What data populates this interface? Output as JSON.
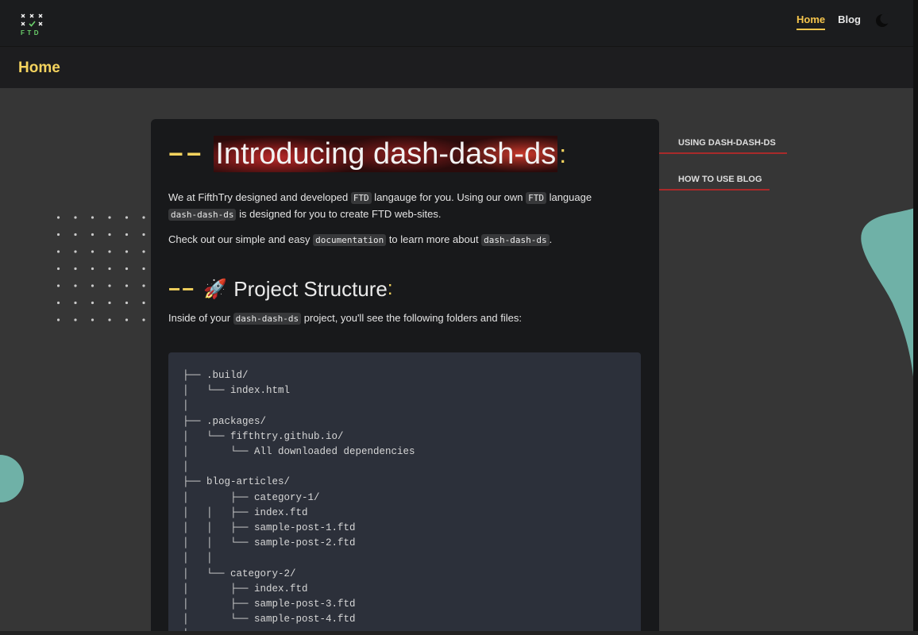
{
  "header": {
    "logo_letters": "FTD",
    "nav": [
      {
        "label": "Home",
        "active": true
      },
      {
        "label": "Blog",
        "active": false
      }
    ],
    "theme_icon": "moon-icon"
  },
  "page": {
    "title": "Home"
  },
  "article": {
    "title": "Introducing dash-dash-ds",
    "intro": {
      "t1": "We at FifthTry designed and developed ",
      "c1": "FTD",
      "t2": " langauge for you. Using our own ",
      "c2": "FTD",
      "t3": " language ",
      "c3": "dash-dash-ds",
      "t4": " is designed for you to create FTD web-sites."
    },
    "docs": {
      "t1": "Check out our simple and easy ",
      "c1": "documentation",
      "t2": " to learn more about ",
      "c2": "dash-dash-ds",
      "t3": "."
    },
    "section_title": "Project Structure",
    "section_icon": "rocket-icon",
    "structure_text": {
      "t1": "Inside of your ",
      "c1": "dash-dash-ds",
      "t2": " project, you'll see the following folders and files:"
    },
    "tree": "├── .build/\n│   └── index.html\n│\n├── .packages/\n│   └── fifthtry.github.io/\n│       └── All downloaded dependencies\n│\n├── blog-articles/\n│       ├── category-1/\n│   │   ├── index.ftd\n│   │   ├── sample-post-1.ftd\n│   │   └── sample-post-2.ftd\n│   │\n│   └── category-2/\n│       ├── index.ftd\n│       ├── sample-post-3.ftd\n│       └── sample-post-4.ftd\n│"
  },
  "toc": [
    {
      "label": "USING DASH-DASH-DS"
    },
    {
      "label": "HOW TO USE BLOG"
    }
  ],
  "colors": {
    "accent": "#f4d35e",
    "background": "#363636",
    "card": "#18191b",
    "code_bg": "#2c303a",
    "toc_underline": "#a92a2a",
    "blob": "#6fb1a7"
  }
}
